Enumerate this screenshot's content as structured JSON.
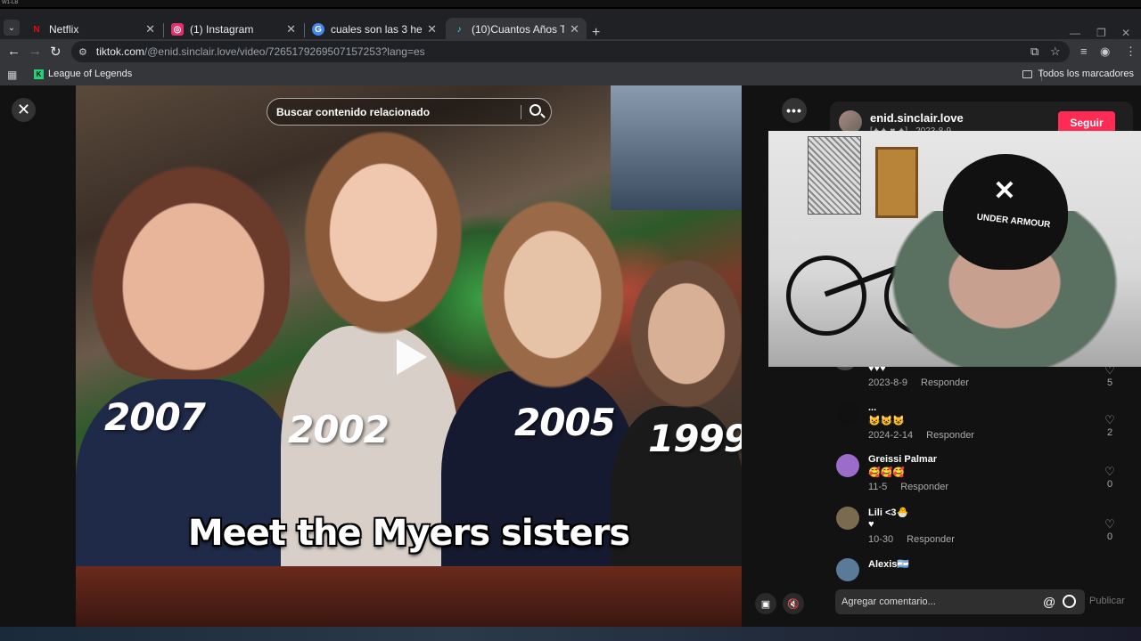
{
  "titlebar_text": "W1-LB",
  "tabs": [
    {
      "label": "Netflix",
      "icon": "N",
      "color": "#e50914",
      "active": false
    },
    {
      "label": "(1) Instagram",
      "icon": "◎",
      "color": "#e1306c",
      "active": false
    },
    {
      "label": "cuales son las 3 hermanas de e",
      "icon": "G",
      "color": "#4285f4",
      "active": false
    },
    {
      "label": "(10)Cuantos Años Tienen Las H",
      "icon": "♪",
      "color": "#25f4ee",
      "active": true
    }
  ],
  "address": {
    "host": "tiktok.com",
    "path": "/@enid.sinclair.love/video/7265179269507157253?lang=es"
  },
  "bookmarks": {
    "item": "League of Legends",
    "all": "Todos los marcadores"
  },
  "video": {
    "search_placeholder": "Buscar contenido relacionado",
    "years": [
      "2007",
      "2002",
      "2005",
      "1999"
    ],
    "caption": "Meet the Myers sisters",
    "state": "paused"
  },
  "author": {
    "name": "enid.sinclair.love",
    "meta": "[✦✦ ♥ ✦] · 2023-8-9",
    "follow_label": "Seguir"
  },
  "webcam": {
    "cap_text": "UNDER ARMOUR"
  },
  "comments": [
    {
      "name": "",
      "text": "♥♥♥",
      "date": "2023-8-9",
      "reply": "Responder",
      "likes": "5",
      "avatar_color": "#444"
    },
    {
      "name": "...",
      "text": "😺😺😺",
      "date": "2024-2-14",
      "reply": "Responder",
      "likes": "2",
      "avatar_color": "#111"
    },
    {
      "name": "Greissi Palmar",
      "text": "🥰🥰🥰",
      "date": "11-5",
      "reply": "Responder",
      "likes": "0",
      "avatar_color": "#9b6cc9"
    },
    {
      "name": "Lili <3🐣",
      "text": "♥",
      "date": "10-30",
      "reply": "Responder",
      "likes": "0",
      "avatar_color": "#7a6a50"
    },
    {
      "name": "Alexis🇦🇷",
      "text": "",
      "date": "",
      "reply": "",
      "likes": "",
      "avatar_color": "#5a7a9a"
    }
  ],
  "comment_input": {
    "placeholder": "Agregar comentario...",
    "publish": "Publicar"
  }
}
